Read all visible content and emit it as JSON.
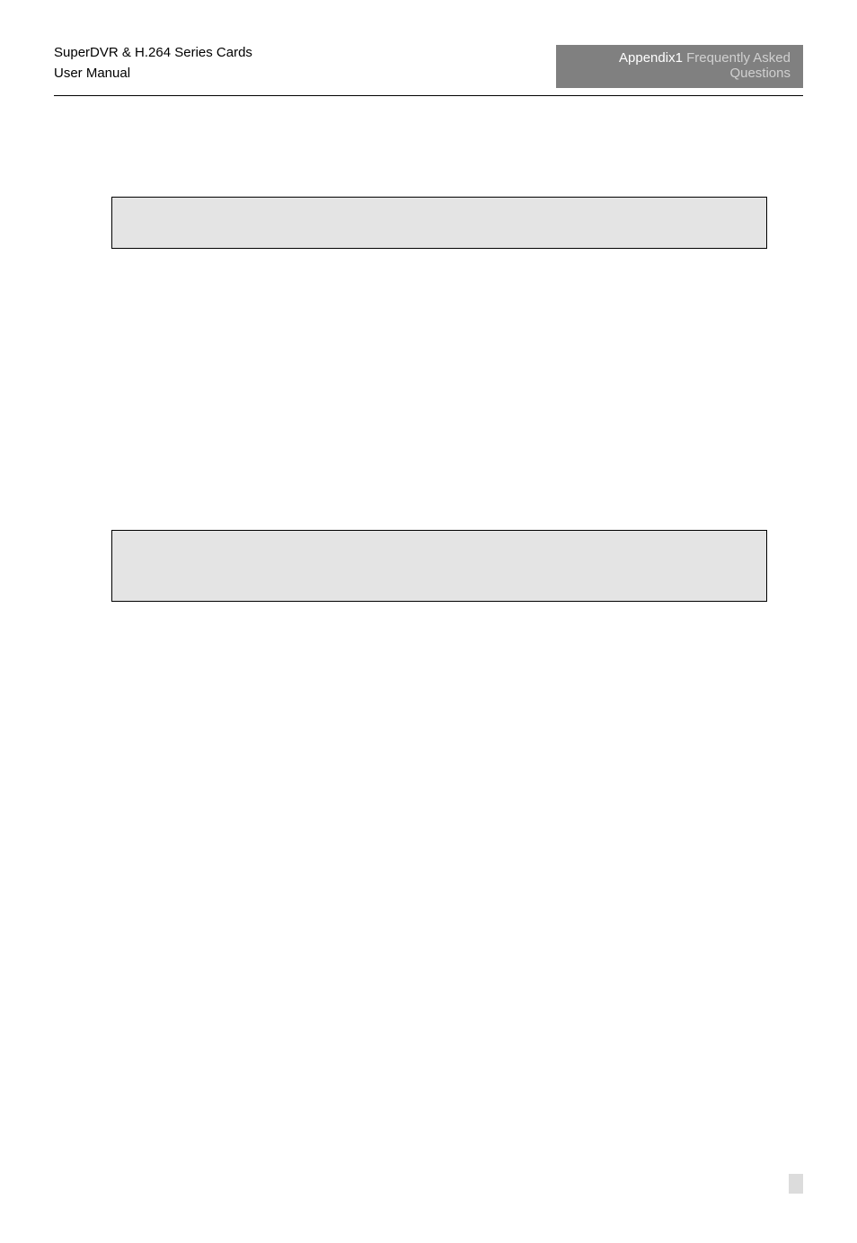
{
  "header": {
    "left": {
      "line1": "SuperDVR & H.264 Series Cards",
      "line2": "User Manual"
    },
    "right": {
      "prefix": "Appendix1",
      "line1_suffix": " Frequently Asked",
      "line2": "Questions"
    }
  }
}
